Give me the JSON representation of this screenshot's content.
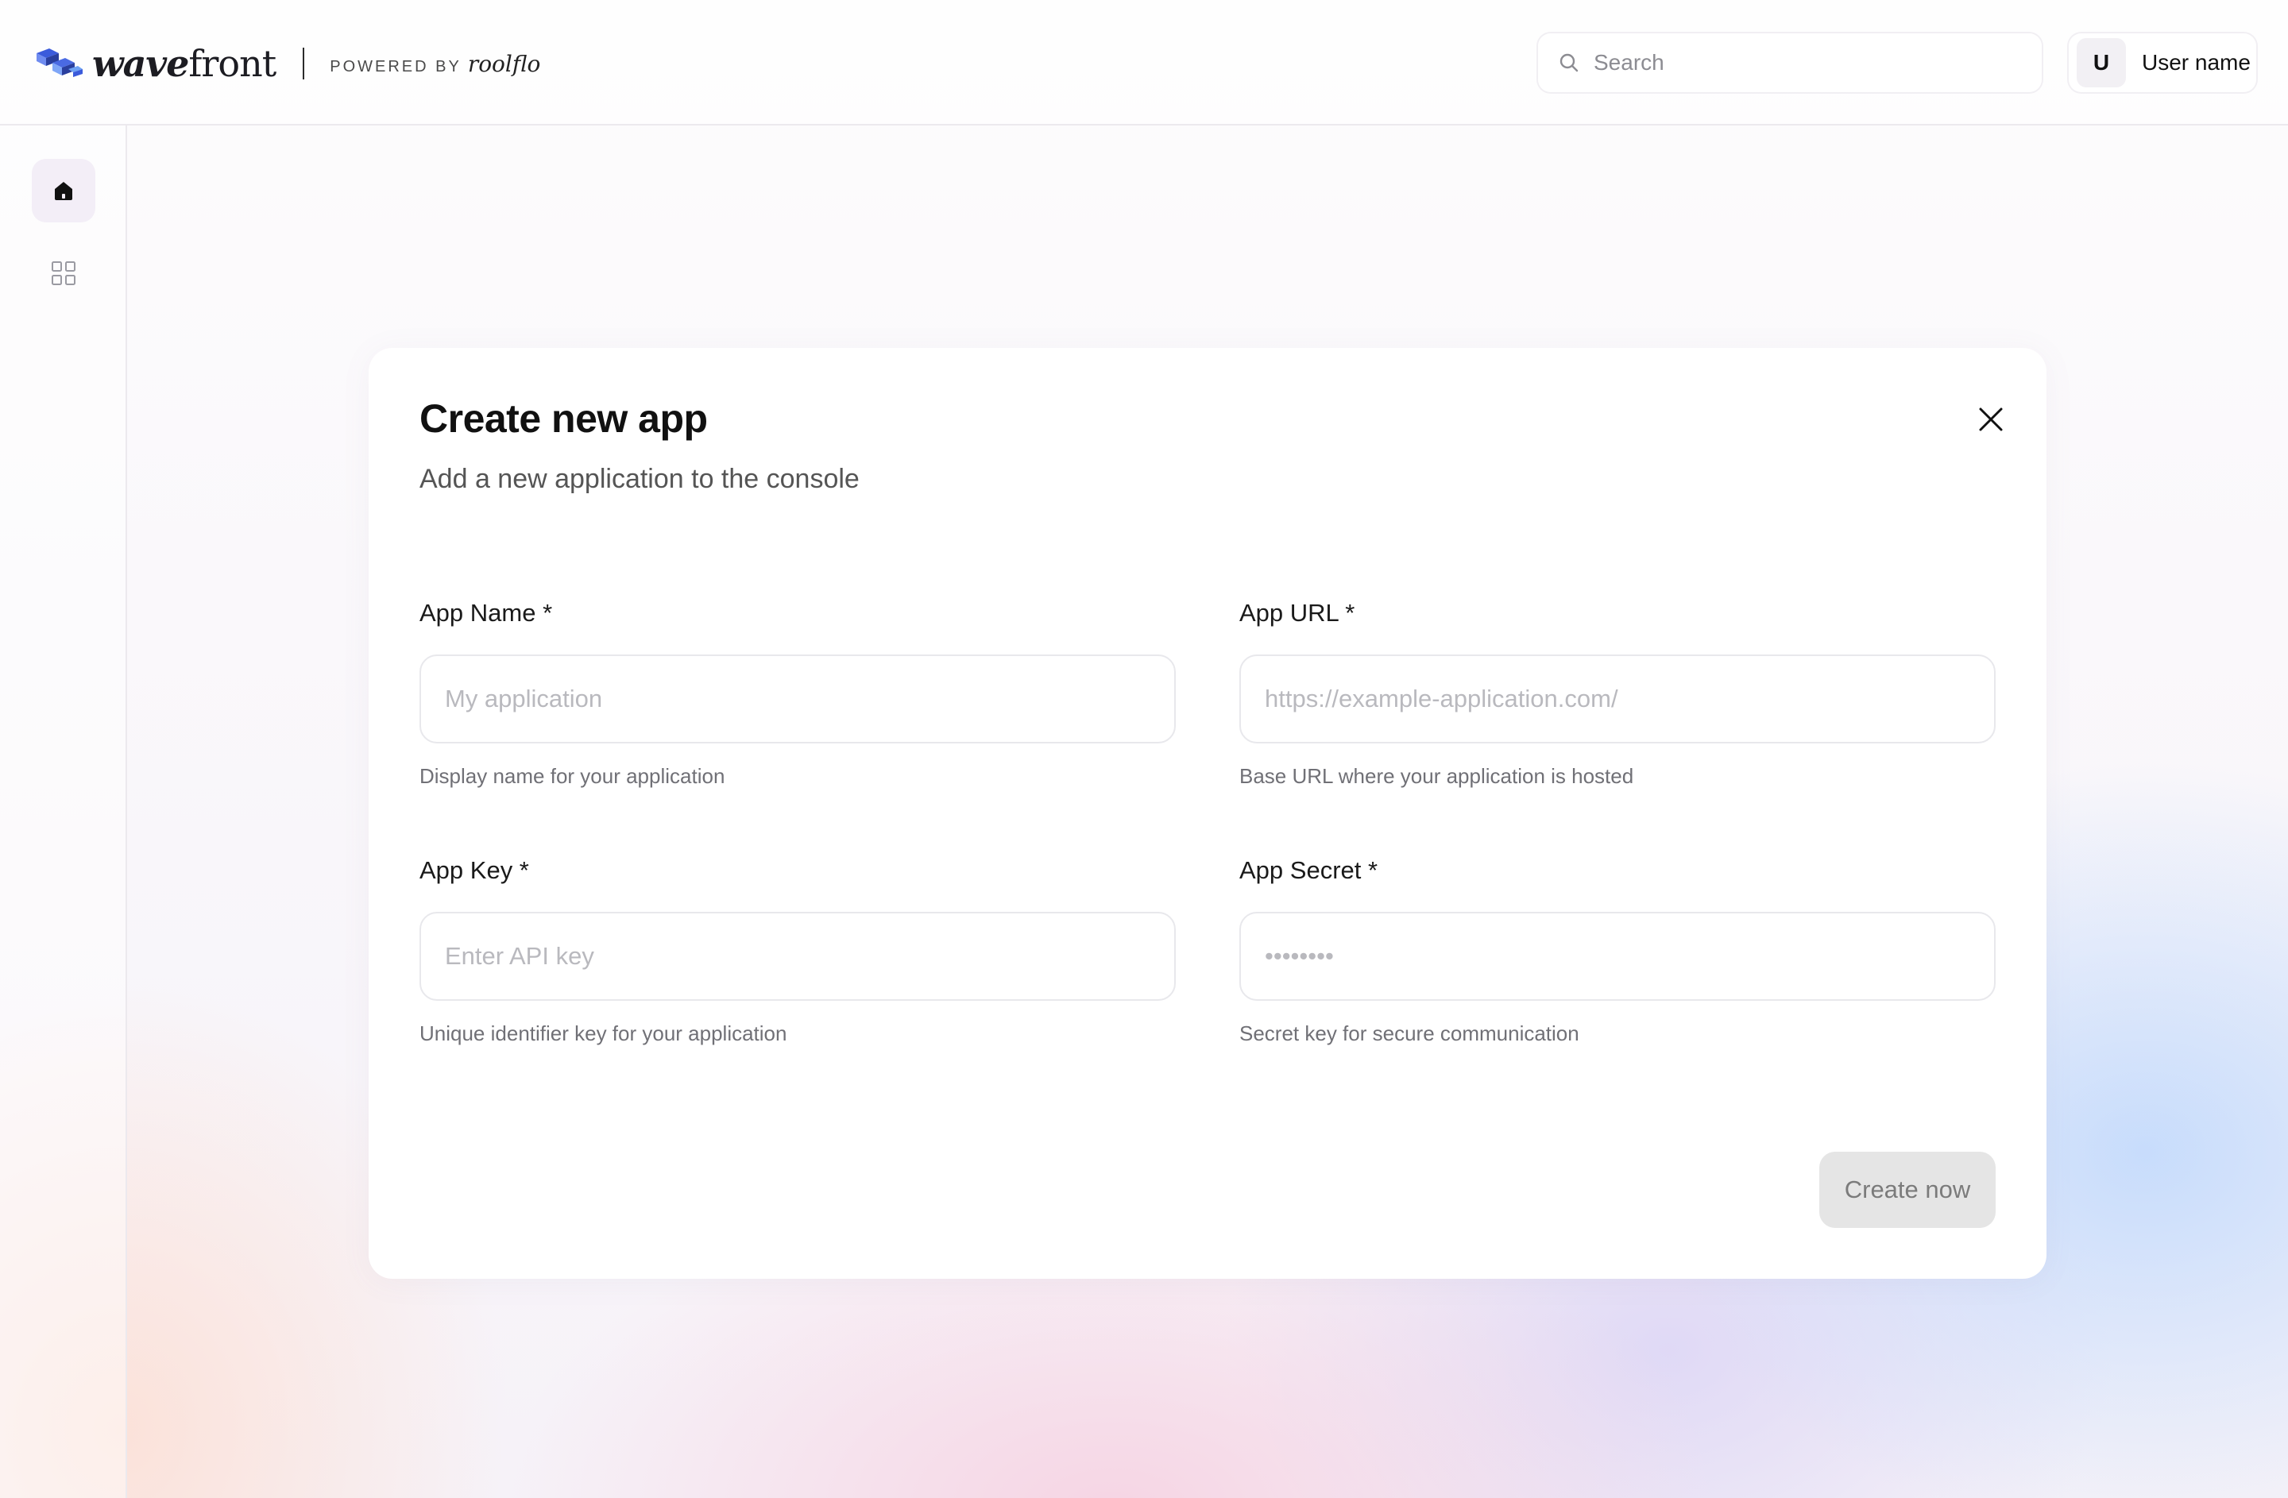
{
  "header": {
    "brand_name_part1": "wave",
    "brand_name_part2": "front",
    "powered_by": "POWERED BY",
    "powered_brand": "roolflo",
    "search_placeholder": "Search",
    "user_initial": "U",
    "user_name": "User name"
  },
  "sidebar": {
    "items": [
      {
        "icon": "home-icon",
        "active": true
      },
      {
        "icon": "grid-icon",
        "active": false
      }
    ]
  },
  "modal": {
    "title": "Create new app",
    "subtitle": "Add a new application to the console",
    "fields": {
      "app_name": {
        "label": "App Name *",
        "value": "",
        "placeholder": "My application",
        "help": "Display name for your application"
      },
      "app_url": {
        "label": "App URL *",
        "value": "",
        "placeholder": "https://example-application.com/",
        "help": "Base URL where your application is hosted"
      },
      "app_key": {
        "label": "App Key *",
        "value": "",
        "placeholder": "Enter API key",
        "help": "Unique identifier key for your application"
      },
      "app_secret": {
        "label": "App Secret *",
        "value": "",
        "placeholder": "••••••••",
        "help": "Secret key for secure communication"
      }
    },
    "submit_label": "Create now"
  },
  "colors": {
    "brand_blue": "#3b5bdb",
    "brand_light_blue": "#74a9f5",
    "submit_disabled_bg": "#e5e5e5",
    "submit_disabled_text": "#7b7b7b"
  }
}
